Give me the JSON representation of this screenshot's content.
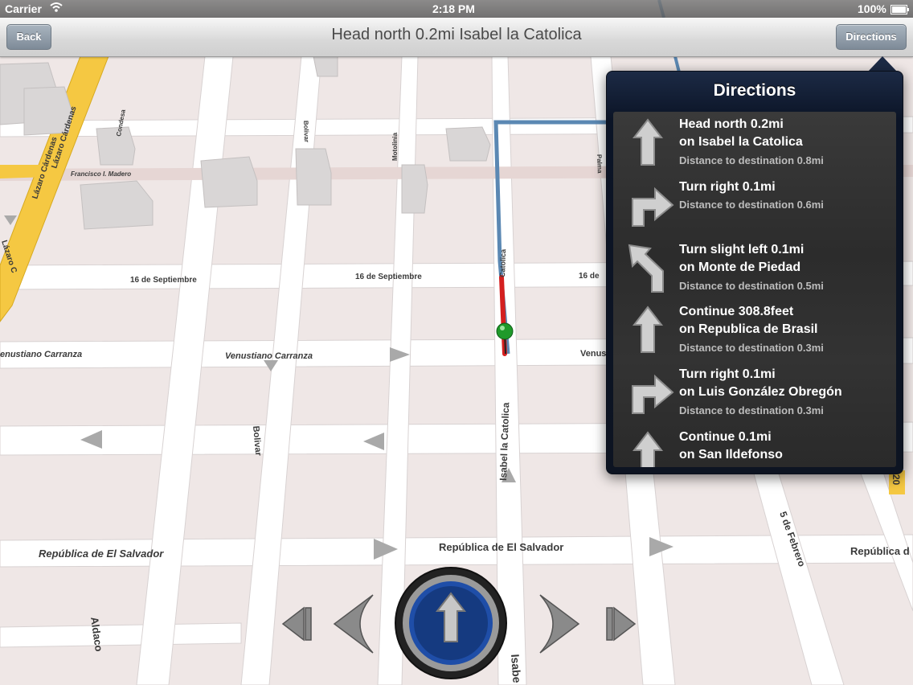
{
  "status_bar": {
    "carrier": "Carrier",
    "time": "2:18 PM",
    "battery": "100%",
    "wifi_icon": "wifi-icon",
    "battery_icon": "battery-icon"
  },
  "navbar": {
    "back_label": "Back",
    "title": "Head north 0.2mi Isabel la Catolica",
    "directions_label": "Directions"
  },
  "popover": {
    "title": "Directions",
    "steps": [
      {
        "icon": "straight-arrow-icon",
        "line1": "Head north 0.2mi",
        "line2": "on Isabel la Catolica",
        "distance": "Distance to destination 0.8mi"
      },
      {
        "icon": "turn-right-icon",
        "line1": "Turn right 0.1mi",
        "line2": "",
        "distance": "Distance to destination 0.6mi"
      },
      {
        "icon": "slight-left-icon",
        "line1": "Turn slight left 0.1mi",
        "line2": "on Monte de Piedad",
        "distance": "Distance to destination 0.5mi"
      },
      {
        "icon": "straight-arrow-icon",
        "line1": "Continue 308.8feet",
        "line2": "on Republica de Brasil",
        "distance": "Distance to destination 0.3mi"
      },
      {
        "icon": "turn-right-icon",
        "line1": "Turn right 0.1mi",
        "line2": "on Luis González Obregón",
        "distance": "Distance to destination 0.3mi"
      },
      {
        "icon": "straight-arrow-icon",
        "line1": "Continue 0.1mi",
        "line2": "on San Ildefonso",
        "distance": ""
      }
    ]
  },
  "map": {
    "streets": {
      "isabel_la_catolica": "Isabel la Catolica",
      "isabel_short": "Isabe",
      "isabel_route": "Catolica",
      "sep16_a": "16 de Septiembre",
      "sep16_b": "16 de Septiembre",
      "sep16_c": "16 de",
      "carranza_a": "enustiano Carranza",
      "carranza_b": "Venustiano Carranza",
      "carranza_c": "Venus",
      "salvador_a": "República de El Salvador",
      "salvador_b": "República de El Salvador",
      "salvador_c": "República d",
      "bolivar_a": "Bolivar",
      "bolivar_b": "Bolivar",
      "motolinia": "Motolinia",
      "madero": "Francisco I. Madero",
      "lazaro_a": "Lázaro Cárdenas",
      "lazaro_b": "Lázaro Cárdenas",
      "lazaro_c": "Lázaro C",
      "condesa": "Condesa",
      "aldaco": "Aldaco",
      "febrero": "5 de Febrero",
      "palma": "Palma",
      "route_20": "20"
    }
  },
  "controls": {
    "first": "skip-back-icon",
    "prev": "previous-icon",
    "center": "compass-arrow-icon",
    "next": "next-icon",
    "last": "skip-forward-icon"
  }
}
